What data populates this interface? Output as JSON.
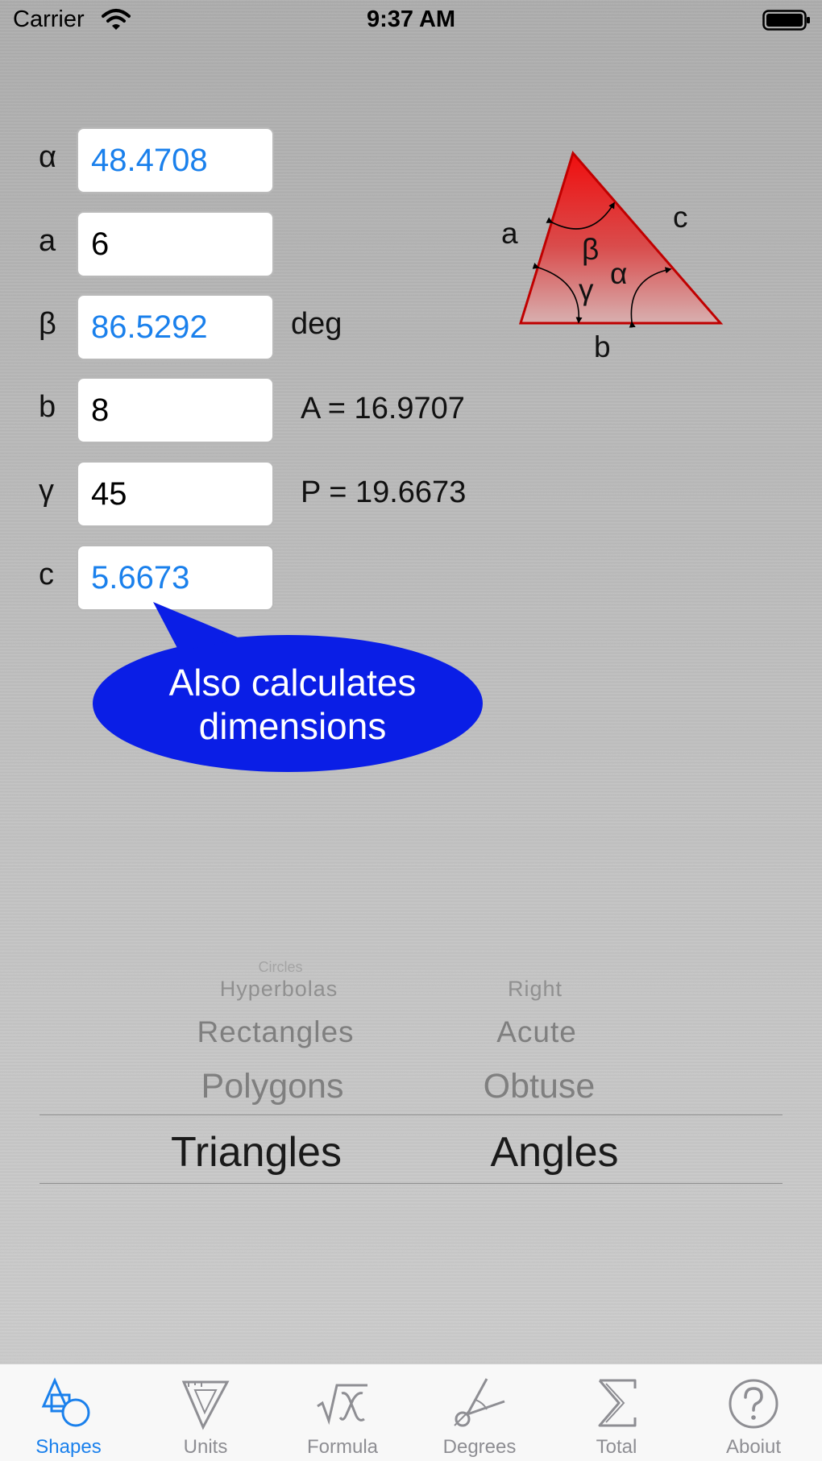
{
  "status_bar": {
    "carrier": "Carrier",
    "time": "9:37 AM"
  },
  "fields": [
    {
      "label": "α",
      "value": "48.4708",
      "computed": true
    },
    {
      "label": "a",
      "value": "6",
      "computed": false
    },
    {
      "label": "β",
      "value": "86.5292",
      "computed": true
    },
    {
      "label": "b",
      "value": "8",
      "computed": false
    },
    {
      "label": "γ",
      "value": "45",
      "computed": false
    },
    {
      "label": "c",
      "value": "5.6673",
      "computed": true
    }
  ],
  "unit_label": "deg",
  "results": {
    "area": "A = 16.9707",
    "perimeter": "P = 19.6673"
  },
  "diagram": {
    "side_a": "a",
    "side_b": "b",
    "side_c": "c",
    "angle_alpha": "α",
    "angle_beta": "β",
    "angle_gamma": "γ",
    "fill_color": "#e81818",
    "stroke_color": "#c00000"
  },
  "callout": {
    "line1": "Also calculates",
    "line2": "dimensions",
    "color": "#0a1ee6"
  },
  "picker": {
    "left_column": {
      "above": [
        "Circles",
        "Hyperbolas",
        "Rectangles",
        "Polygons"
      ],
      "selected": "Triangles"
    },
    "right_column": {
      "above": [
        "Right",
        "Acute",
        "Obtuse"
      ],
      "selected": "Angles"
    }
  },
  "tabs": [
    {
      "label": "Shapes",
      "icon": "shapes-icon",
      "active": true
    },
    {
      "label": "Units",
      "icon": "set-square-icon",
      "active": false
    },
    {
      "label": "Formula",
      "icon": "formula-icon",
      "active": false
    },
    {
      "label": "Degrees",
      "icon": "compass-icon",
      "active": false
    },
    {
      "label": "Total",
      "icon": "sigma-icon",
      "active": false
    },
    {
      "label": "Aboiut",
      "icon": "question-icon",
      "active": false
    }
  ],
  "colors": {
    "accent": "#1a80ec",
    "computed_text": "#1a80ec"
  }
}
